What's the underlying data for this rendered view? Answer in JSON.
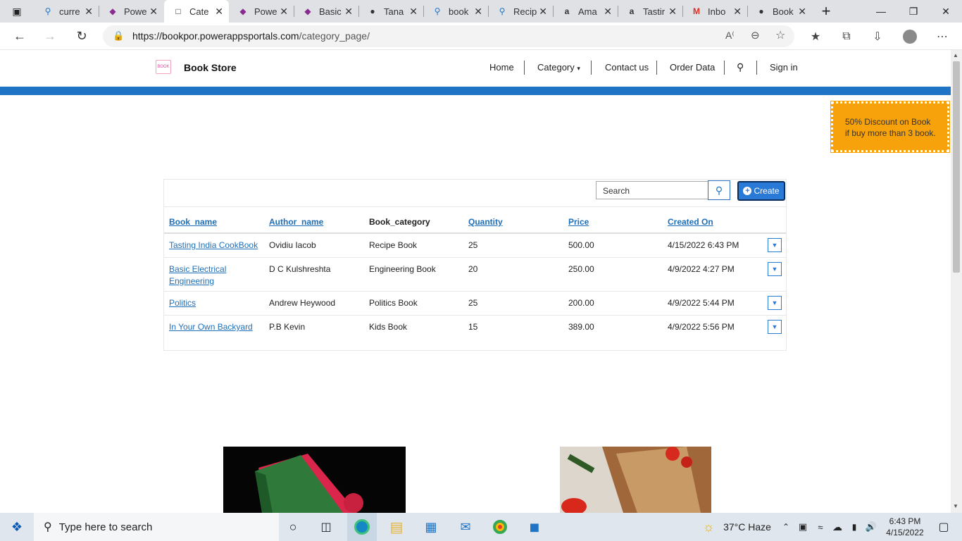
{
  "browser": {
    "tabs": [
      {
        "label": "curre",
        "icon": "search-icon"
      },
      {
        "label": "Powe",
        "icon": "powerapps-icon"
      },
      {
        "label": "Cate",
        "icon": "page-icon",
        "active": true
      },
      {
        "label": "Powe",
        "icon": "powerapps-icon"
      },
      {
        "label": "Basic",
        "icon": "powerapps-icon"
      },
      {
        "label": "Tana",
        "icon": "github-icon"
      },
      {
        "label": "book",
        "icon": "search-icon"
      },
      {
        "label": "Recip",
        "icon": "search-icon"
      },
      {
        "label": "Ama",
        "icon": "amazon-icon"
      },
      {
        "label": "Tastir",
        "icon": "amazon-icon"
      },
      {
        "label": "Inbo",
        "icon": "gmail-icon"
      },
      {
        "label": "Book",
        "icon": "github-icon"
      }
    ],
    "url_host": "https://bookpor.powerappsportals.com",
    "url_path": "/category_page/"
  },
  "site": {
    "brand": "Book Store",
    "logo_text": "BOOK",
    "nav": {
      "home": "Home",
      "category": "Category",
      "contact": "Contact us",
      "order": "Order Data",
      "signin": "Sign in"
    },
    "promo_line1": "50% Discount on Book",
    "promo_line2": "if buy more than 3 book."
  },
  "table": {
    "search_placeholder": "Search",
    "create_label": "Create",
    "columns": [
      "Book_name",
      "Author_name",
      "Book_category",
      "Quantity",
      "Price",
      "Created On"
    ],
    "rows": [
      {
        "book_name": "Tasting India CookBook",
        "author": "Ovidiu Iacob",
        "category": "Recipe Book",
        "quantity": "25",
        "price": "500.00",
        "created": "4/15/2022 6:43 PM"
      },
      {
        "book_name": "Basic Electrical Engineering",
        "author": "D C Kulshreshta",
        "category": "Engineering Book",
        "quantity": "20",
        "price": "250.00",
        "created": "4/9/2022 4:27 PM"
      },
      {
        "book_name": "Politics",
        "author": "Andrew Heywood",
        "category": "Politics Book",
        "quantity": "25",
        "price": "200.00",
        "created": "4/9/2022 5:44 PM"
      },
      {
        "book_name": "In Your Own Backyard",
        "author": "P.B Kevin",
        "category": "Kids Book",
        "quantity": "15",
        "price": "389.00",
        "created": "4/9/2022 5:56 PM"
      }
    ]
  },
  "taskbar": {
    "search_placeholder": "Type here to search",
    "weather": "37°C  Haze",
    "time": "6:43 PM",
    "date": "4/15/2022"
  },
  "colors": {
    "accent": "#1f74c5",
    "promo": "#f7a20a",
    "link": "#1f6fb8"
  }
}
